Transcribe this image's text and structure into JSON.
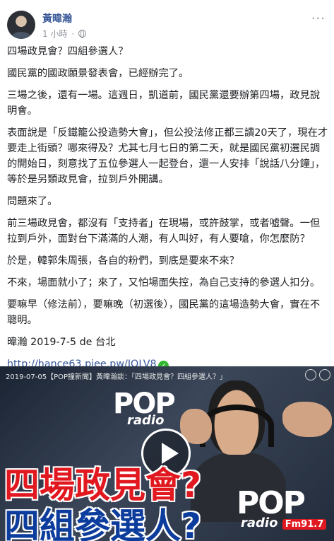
{
  "post": {
    "author": "黃暐瀚",
    "time": "1 小時",
    "paragraphs": [
      "四場政見會？四組參選人？",
      "國民黨的國政願景發表會，已經辦完了。",
      "三場之後，還有一場。這週日，凱道前，國民黨還要辦第四場，政見說明會。",
      "表面說是「反鐵籠公投造勢大會」，但公投法修正都三讀20天了，現在才要走上街頭？哪來得及？尤其七月七日的第二天，就是國民黨初選民調的開始日，刻意找了五位參選人一起登台，還一人安排「說話八分鐘」，等於是另類政見會，拉到戶外開講。",
      "問題來了。",
      "前三場政見會，都沒有「支持者」在現場，或許鼓掌，或者噓聲。一但拉到戶外，面對台下滿滿的人潮，有人叫好，有人要嗆，你怎麼防？",
      "於是，韓郭朱周張，各自的粉們，到底是要來不來？",
      "不來，場面就小了；來了，又怕場面失控，為自己支持的參選人扣分。",
      "要嘛早（修法前），要嘛晚（初選後），國民黨的這場造勢大會，實在不聰明。",
      "暐瀚 2019-7-5 de 台北"
    ],
    "link": "http://hance63.piee.pw/JQLV8"
  },
  "video": {
    "title": "2019-07-05【POP撞新聞】黃暐瀚談：「四場政見會？四組參選人？」",
    "logo_pop": "POP",
    "logo_radio": "radio",
    "logo_fm": "Fm91.7",
    "headline1": "四場政見會?",
    "headline2": "四組參選人?"
  },
  "icons": {
    "globe": "globe-icon",
    "more": "more-options-icon",
    "verified": "check-icon",
    "play": "play-icon"
  }
}
